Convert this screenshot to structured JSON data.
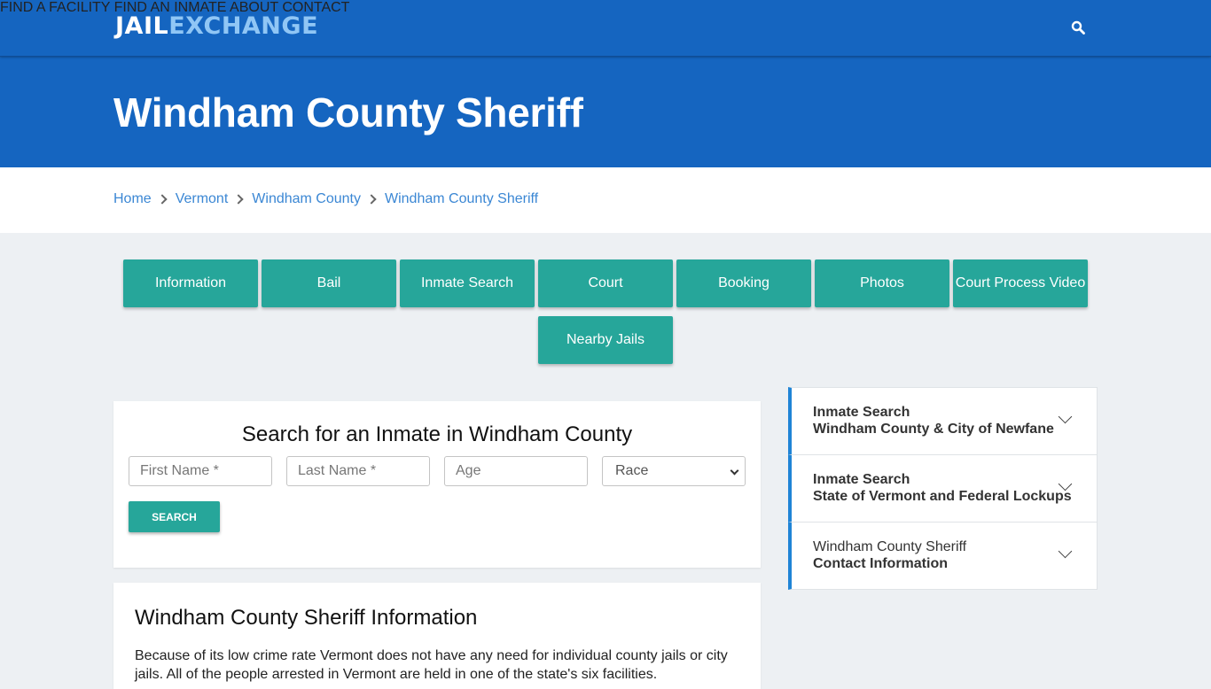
{
  "header": {
    "logo_part1": "JAIL",
    "logo_part2": "EXCHANGE",
    "nav": [
      "FIND A FACILITY",
      "FIND AN INMATE",
      "ABOUT",
      "CONTACT"
    ],
    "search_icon": "search-icon"
  },
  "hero": {
    "title": "Windham County Sheriff"
  },
  "breadcrumb": [
    "Home",
    "Vermont",
    "Windham County",
    "Windham County Sheriff"
  ],
  "tabs": [
    "Information",
    "Bail",
    "Inmate Search",
    "Court",
    "Booking",
    "Photos",
    "Court Process Video",
    "Nearby Jails"
  ],
  "search": {
    "title": "Search for an Inmate in Windham County",
    "first_name_placeholder": "First Name *",
    "last_name_placeholder": "Last Name *",
    "age_placeholder": "Age",
    "race_selected": "Race",
    "button": "SEARCH"
  },
  "sidebar": [
    {
      "line1": "Inmate Search",
      "line2": "Windham County & City of Newfane"
    },
    {
      "line1": "Inmate Search",
      "line2": "State of Vermont and Federal Lockups"
    },
    {
      "line1": "Windham County Sheriff",
      "line2": "Contact Information"
    }
  ],
  "info": {
    "title": "Windham County Sheriff Information",
    "text": "Because of its low crime rate Vermont does not have any need for individual county jails or city jails. All of the people arrested in Vermont are held in one of the state's six facilities."
  },
  "colors": {
    "brand_blue": "#1565c0",
    "teal": "#26a69a",
    "link": "#3b87d4",
    "accent_border": "#1f84d6"
  }
}
